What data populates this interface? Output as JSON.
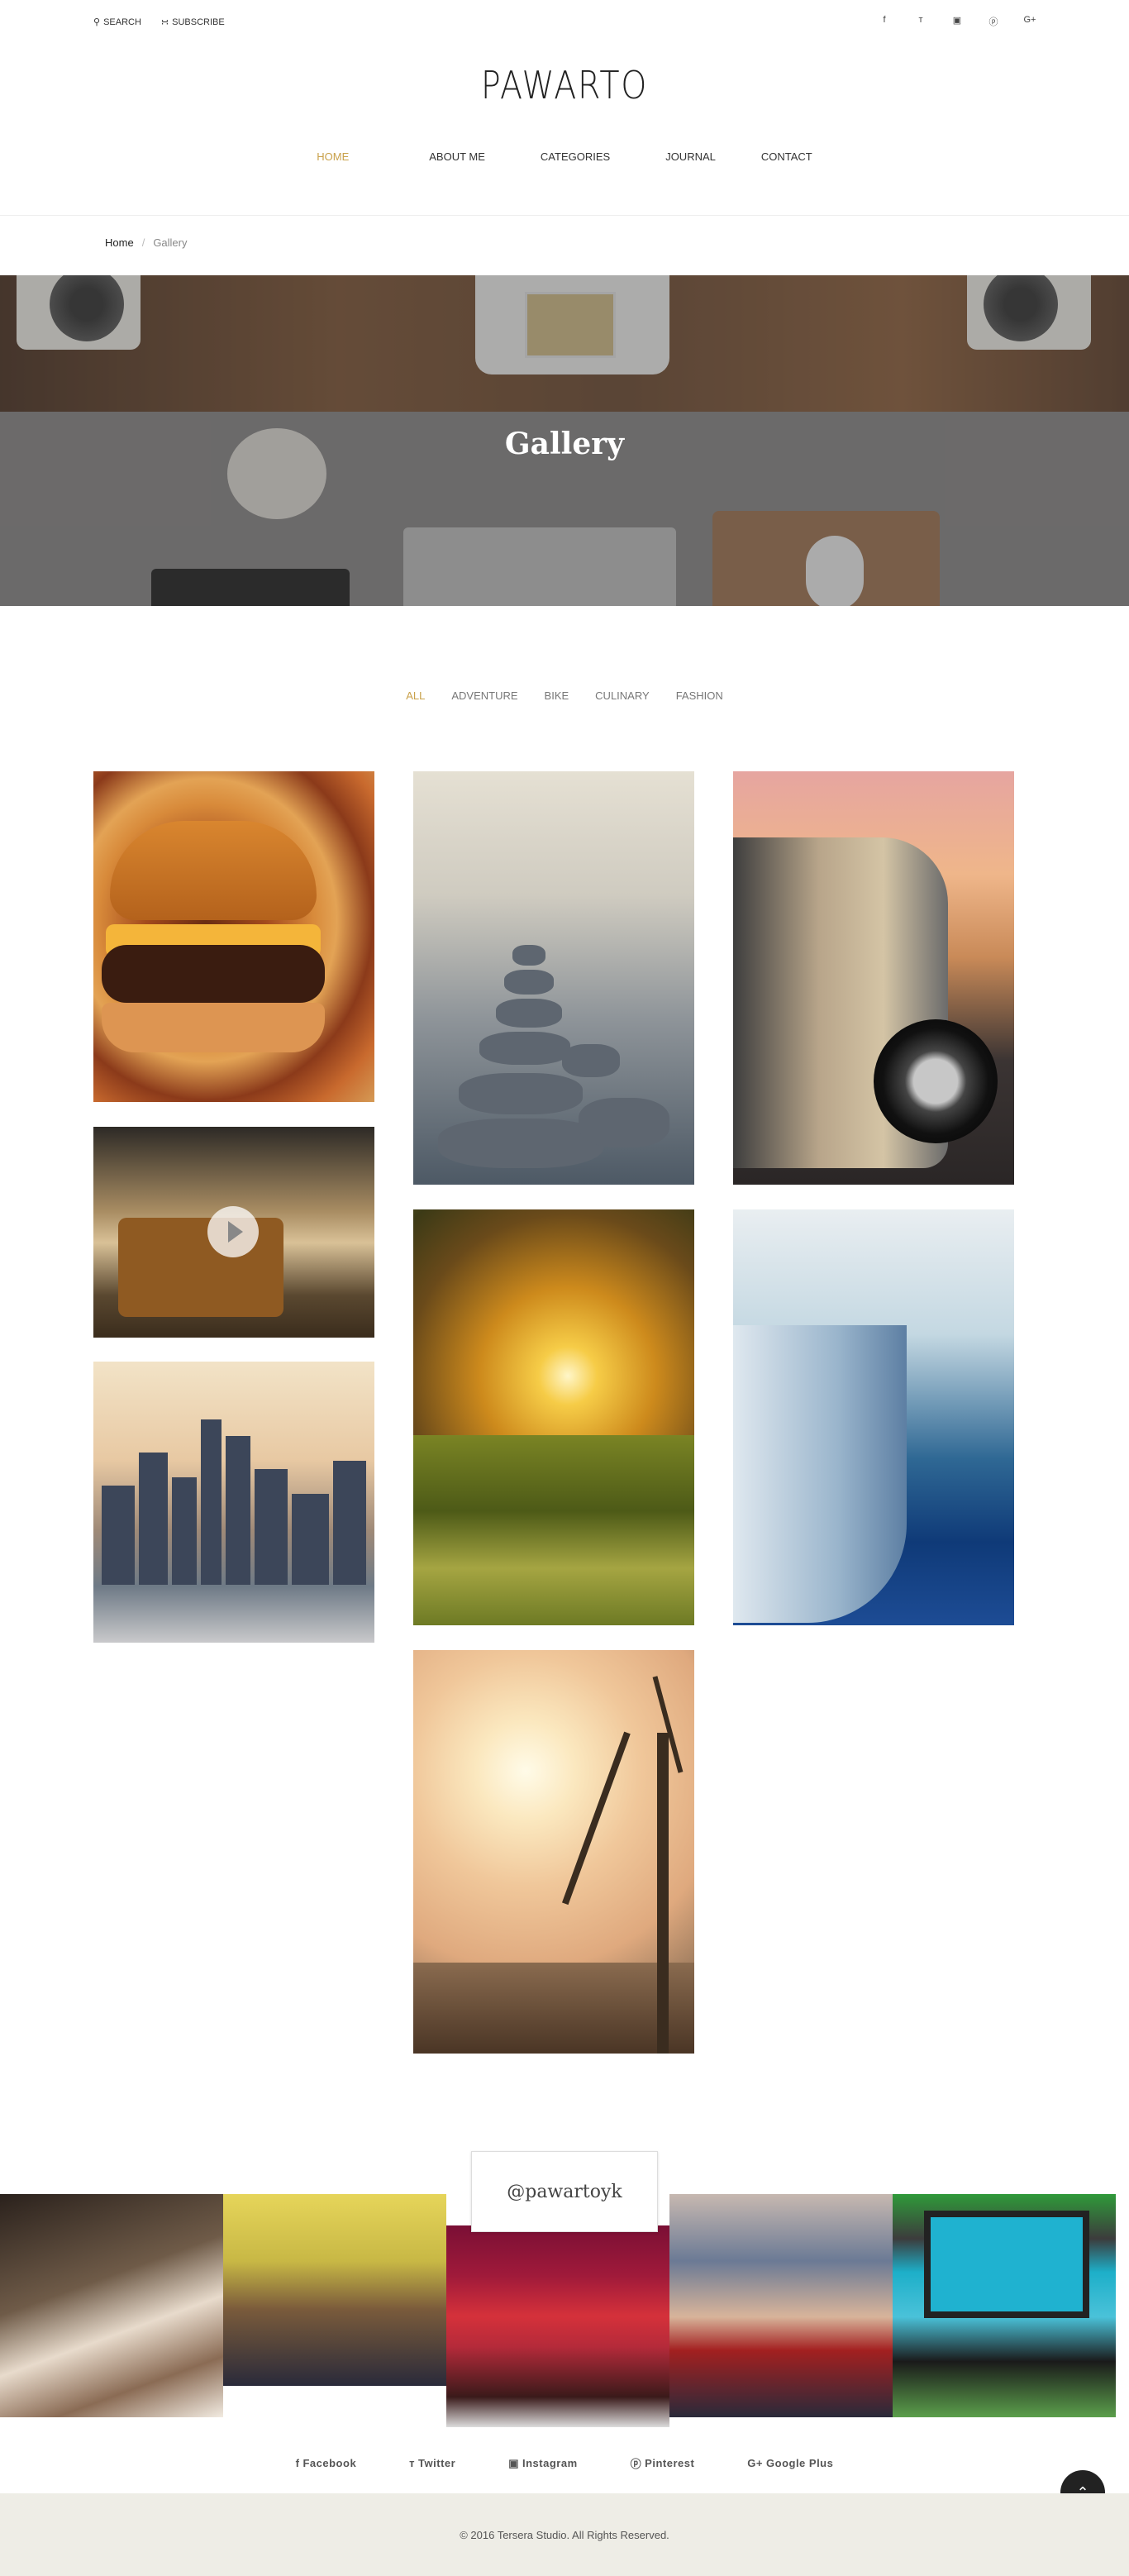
{
  "topbar": {
    "search_label": "SEARCH",
    "subscribe_label": "SUBSCRIBE",
    "social": [
      {
        "icon": "facebook-icon",
        "glyph": "f"
      },
      {
        "icon": "twitter-icon",
        "glyph": "ᴛ"
      },
      {
        "icon": "instagram-icon",
        "glyph": "▣"
      },
      {
        "icon": "pinterest-icon",
        "glyph": "ⓟ"
      },
      {
        "icon": "google-plus-icon",
        "glyph": "G+"
      }
    ]
  },
  "site": {
    "logo": "PAWARTO"
  },
  "nav": {
    "items": [
      "HOME",
      "ABOUT ME",
      "CATEGORIES",
      "JOURNAL",
      "CONTACT"
    ],
    "active": "HOME"
  },
  "breadcrumb": {
    "home": "Home",
    "separator": "/",
    "current": "Gallery"
  },
  "hero": {
    "title": "Gallery"
  },
  "filters": {
    "items": [
      "ALL",
      "ADVENTURE",
      "BIKE",
      "CULINARY",
      "FASHION"
    ],
    "active": "ALL"
  },
  "instagram": {
    "handle": "@pawartoyk"
  },
  "footer": {
    "social": [
      {
        "icon": "facebook-icon",
        "glyph": "f",
        "label": "Facebook"
      },
      {
        "icon": "twitter-icon",
        "glyph": "ᴛ",
        "label": "Twitter"
      },
      {
        "icon": "instagram-icon",
        "glyph": "▣",
        "label": "Instagram"
      },
      {
        "icon": "pinterest-icon",
        "glyph": "ⓟ",
        "label": "Pinterest"
      },
      {
        "icon": "google-plus-icon",
        "glyph": "G+",
        "label": "Google Plus"
      }
    ],
    "copyright": "© 2016 Tersera Studio. All Rights Reserved.",
    "to_top_glyph": "⌃"
  },
  "colors": {
    "accent": "#c9a14a",
    "footer_bg": "#eeede6"
  }
}
